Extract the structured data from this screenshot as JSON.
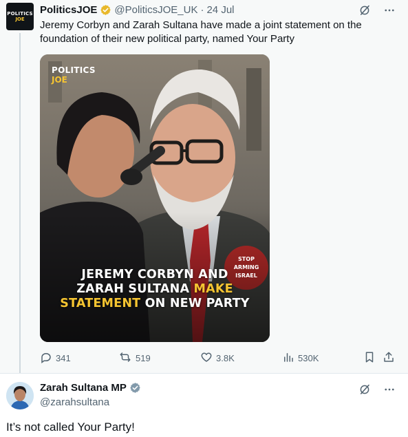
{
  "quoted_tweet": {
    "avatar": {
      "line1": "POLITICS",
      "line2": "JOE"
    },
    "name": "PoliticsJOE",
    "handle": "@PoliticsJOE_UK",
    "separator": "·",
    "date": "24 Jul",
    "text": "Jeremy Corbyn and Zarah Sultana have made a joint statement on the foundation of their new political party, named Your Party",
    "media": {
      "logo_line1": "POLITICS",
      "logo_line2": "JOE",
      "headline_part1": "JEREMY CORBYN AND",
      "headline_part2": "ZARAH SULTANA",
      "headline_highlight1": "MAKE",
      "headline_highlight2": "STATEMENT",
      "headline_part3": "ON NEW PARTY",
      "badge_line1": "STOP",
      "badge_line2": "ARMING",
      "badge_line3": "ISRAEL"
    },
    "stats": {
      "replies": "341",
      "reposts": "519",
      "likes": "3.8K",
      "views": "530K"
    }
  },
  "reply_tweet": {
    "name": "Zarah Sultana MP",
    "handle": "@zarahsultana",
    "text": "It’s not called Your Party!"
  },
  "icons": {
    "verified_gold": "verified-gold-badge",
    "verified_gray": "verified-gray-badge",
    "grok": "grok-icon",
    "more": "more-icon",
    "reply": "reply-icon",
    "repost": "repost-icon",
    "like": "like-icon",
    "views": "views-icon",
    "bookmark": "bookmark-icon",
    "share": "share-icon"
  },
  "colors": {
    "accent_gold": "#f5c431",
    "muted_text": "#536471",
    "verified_gold": "#e8b829",
    "verified_gray": "#829aab"
  }
}
